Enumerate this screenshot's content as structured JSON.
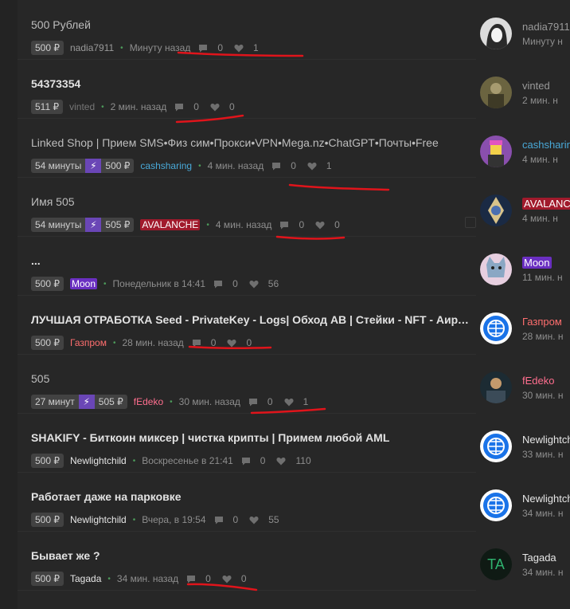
{
  "threads": [
    {
      "title": "500 Рублей",
      "light": true,
      "badges": [
        "500 ₽"
      ],
      "user": "nadia7911",
      "user_style": "u-gray",
      "time": "Минуту назад",
      "comments": "0",
      "likes": "1"
    },
    {
      "title": "54373354",
      "light": false,
      "badges": [
        "511 ₽"
      ],
      "user": "vinted",
      "user_style": "u-dim",
      "time": "2 мин. назад",
      "comments": "0",
      "likes": "0"
    },
    {
      "title": "Linked Shop | Прием SMS•Физ сим•Прокси•VPN•Mega.nz•ChatGPT•Почты•Free",
      "light": true,
      "badges": [
        "54 минуты",
        "⚡",
        "500 ₽"
      ],
      "user": "cashsharing",
      "user_style": "u-cyan",
      "time": "4 мин. назад",
      "comments": "0",
      "likes": "1"
    },
    {
      "title": "Имя 505",
      "light": true,
      "badges": [
        "54 минуты",
        "⚡",
        "505 ₽"
      ],
      "user": "AVALANCHE",
      "user_style": "u-avalanche",
      "time": "4 мин. назад",
      "comments": "0",
      "likes": "0"
    },
    {
      "title": "...",
      "light": false,
      "badges": [
        "500 ₽"
      ],
      "user": "Moon",
      "user_style": "u-moon",
      "time": "Понедельник в 14:41",
      "comments": "0",
      "likes": "56"
    },
    {
      "title": "ЛУЧШАЯ ОТРАБОТКА Seed - PrivateKey - Logs| Обход АВ | Стейки - NFT - Аирдропы",
      "light": false,
      "badges": [
        "500 ₽"
      ],
      "user": "Газпром",
      "user_style": "u-red",
      "time": "28 мин. назад",
      "comments": "0",
      "likes": "0"
    },
    {
      "title": "505",
      "light": true,
      "badges": [
        "27 минут",
        "⚡",
        "505 ₽"
      ],
      "user": "fEdeko",
      "user_style": "u-pink",
      "time": "30 мин. назад",
      "comments": "0",
      "likes": "1"
    },
    {
      "title": "SHAKIFY - Биткоин миксер | чистка крипты | Примем любой AML",
      "light": false,
      "badges": [
        "500 ₽"
      ],
      "user": "Newlightchild",
      "user_style": "u-white",
      "time": "Воскресенье в 21:41",
      "comments": "0",
      "likes": "110"
    },
    {
      "title": "Работает даже на парковке",
      "light": false,
      "badges": [
        "500 ₽"
      ],
      "user": "Newlightchild",
      "user_style": "u-white",
      "time": "Вчера, в 19:54",
      "comments": "0",
      "likes": "55"
    },
    {
      "title": "Бывает же ?",
      "light": false,
      "badges": [
        "500 ₽"
      ],
      "user": "Tagada",
      "user_style": "u-white",
      "time": "34 мин. назад",
      "comments": "0",
      "likes": "0"
    }
  ],
  "sidebar": [
    {
      "name": "nadia7911",
      "time": "Минуту н",
      "name_style": "u-gray",
      "avatar": "anime"
    },
    {
      "name": "vinted",
      "time": "2 мин. н",
      "name_style": "u-gray",
      "avatar": "photo"
    },
    {
      "name": "cashsharin",
      "time": "4 мин. н",
      "name_style": "u-cyan",
      "avatar": "lego"
    },
    {
      "name": "AVALANCH",
      "time": "4 мин. н",
      "name_style": "u-avalanche",
      "avatar": "crystal"
    },
    {
      "name": "Moon",
      "time": "11 мин. н",
      "name_style": "u-moon",
      "avatar": "cat"
    },
    {
      "name": "Газпром",
      "time": "28 мин. н",
      "name_style": "u-red",
      "avatar": "globe"
    },
    {
      "name": "fEdeko",
      "time": "30 мин. н",
      "name_style": "u-pink",
      "avatar": "man"
    },
    {
      "name": "Newlightch",
      "time": "33 мин. н",
      "name_style": "u-white",
      "avatar": "globe"
    },
    {
      "name": "Newlightch",
      "time": "34 мин. н",
      "name_style": "u-white",
      "avatar": "globe"
    },
    {
      "name": "Tagada",
      "time": "34 мин. н",
      "name_style": "u-white",
      "avatar": "initials",
      "initials": "TA"
    }
  ],
  "icons": {
    "comment": "comment-icon",
    "like": "heart-icon",
    "bolt": "lightning-icon"
  },
  "colors": {
    "accent_red_marker": "#e0141b",
    "bolt": "#6a46b6",
    "online_dot": "#4c9a5a"
  }
}
